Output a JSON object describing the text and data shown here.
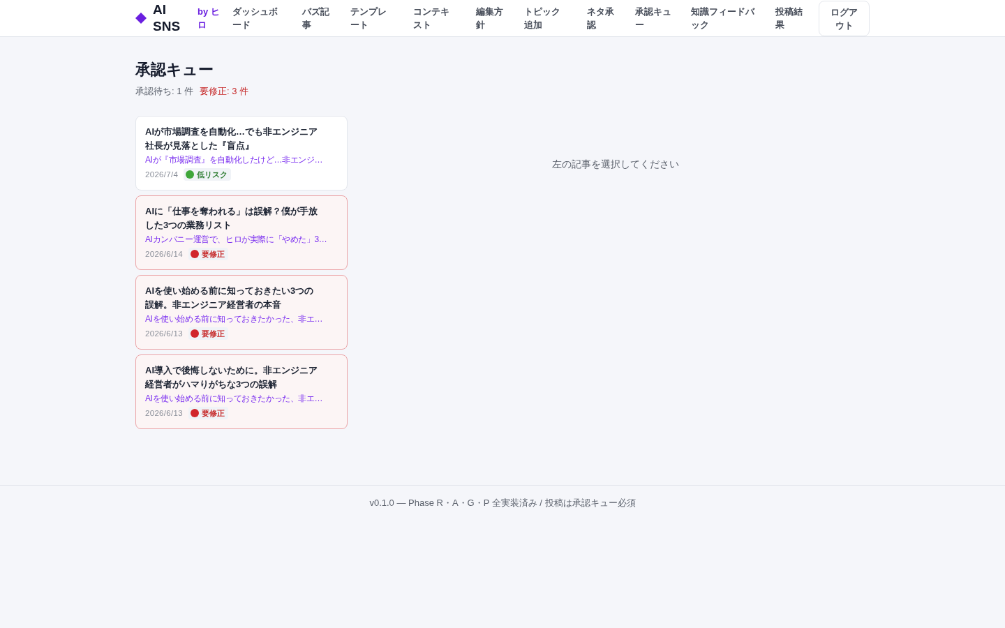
{
  "header": {
    "logo": {
      "title": "AI SNS",
      "byline": "by ヒロ"
    },
    "nav": [
      "ダッシュボード",
      "バズ記事",
      "テンプレート",
      "コンテキスト",
      "編集方針",
      "トピック追加",
      "ネタ承認",
      "承認キュー",
      "知識フィードバック",
      "投稿結果"
    ],
    "logout_button": "ログアウト"
  },
  "page": {
    "title": "承認キュー",
    "counts": [
      {
        "label": "承認待ち: 1 件",
        "kind": "pending"
      },
      {
        "label": "要修正: 3 件",
        "kind": "revision"
      }
    ]
  },
  "queue": [
    {
      "title": "AIが市場調査を自動化…でも非エンジニア社長が見落とした『盲点』",
      "excerpt": "AIが『市場調査』を自動化したけど…非エンジ…",
      "date": "2026/7/4",
      "badge": {
        "label": "低リスク",
        "kind": "low_risk"
      },
      "selected": false
    },
    {
      "title": "AIに「仕事を奪われる」は誤解？僕が手放した3つの業務リスト",
      "excerpt": "AIカンパニー運営で、ヒロが実際に「やめた」3…",
      "date": "2026/6/14",
      "badge": {
        "label": "要修正",
        "kind": "needs_fix"
      },
      "selected": false
    },
    {
      "title": "AIを使い始める前に知っておきたい3つの誤解。非エンジニア経営者の本音",
      "excerpt": "AIを使い始める前に知っておきたかった、非エ…",
      "date": "2026/6/13",
      "badge": {
        "label": "要修正",
        "kind": "needs_fix"
      },
      "selected": false
    },
    {
      "title": "AI導入で後悔しないために。非エンジニア経営者がハマりがちな3つの誤解",
      "excerpt": "AIを使い始める前に知っておきたかった、非エ…",
      "date": "2026/6/13",
      "badge": {
        "label": "要修正",
        "kind": "needs_fix"
      },
      "selected": false
    }
  ],
  "detail": {
    "message": "左の記事を選択してください"
  },
  "footer": "v0.1.0 — Phase R・A・G・P 全実装済み / 投稿は承認キュー必須"
}
